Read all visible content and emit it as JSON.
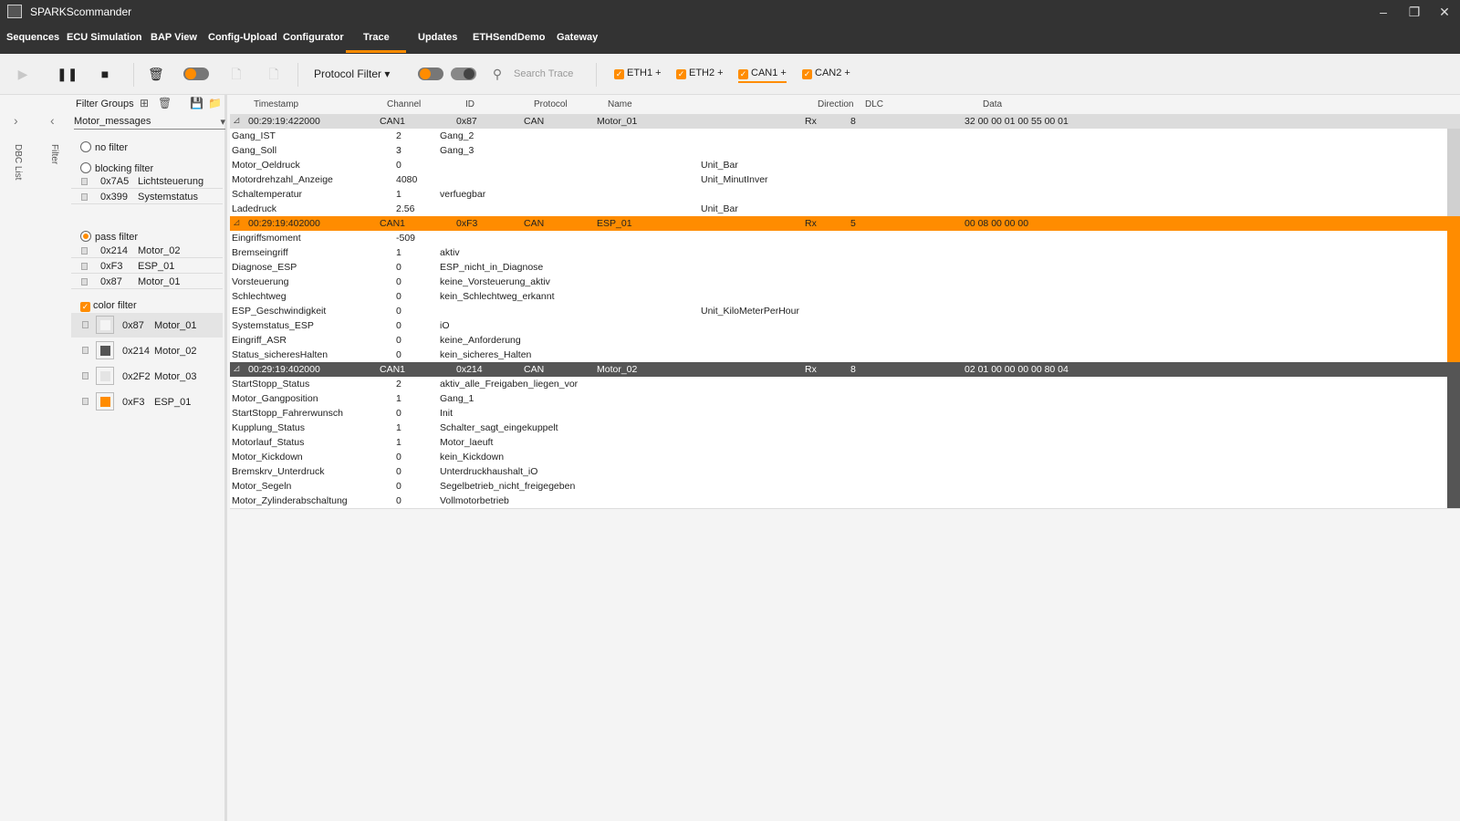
{
  "window": {
    "title": "SPARKScommander"
  },
  "menu": [
    "Sequences",
    "ECU Simulation",
    "BAP View",
    "Config-Upload",
    "Configurator",
    "Trace",
    "Updates",
    "ETHSendDemo",
    "Gateway"
  ],
  "toolbar": {
    "protocol_filter": "Protocol Filter",
    "search_placeholder": "Search Trace",
    "channels": [
      "ETH1",
      "ETH2",
      "CAN1",
      "CAN2"
    ]
  },
  "side": {
    "dbc_list": "DBC List",
    "filter": "Filter"
  },
  "filter_panel": {
    "title": "Filter Groups",
    "group": "Motor_messages",
    "no_filter": "no filter",
    "blocking_filter": "blocking filter",
    "blocking_items": [
      {
        "id": "0x7A5",
        "name": "Lichtsteuerung"
      },
      {
        "id": "0x399",
        "name": "Systemstatus"
      }
    ],
    "pass_filter": "pass filter",
    "pass_items": [
      {
        "id": "0x214",
        "name": "Motor_02"
      },
      {
        "id": "0xF3",
        "name": "ESP_01"
      },
      {
        "id": "0x87",
        "name": "Motor_01"
      }
    ],
    "color_filter": "color filter",
    "color_items": [
      {
        "id": "0x87",
        "name": "Motor_01",
        "color": "#f4f4f4"
      },
      {
        "id": "0x214",
        "name": "Motor_02",
        "color": "#555555"
      },
      {
        "id": "0x2F2",
        "name": "Motor_03",
        "color": "#e4e4e4"
      },
      {
        "id": "0xF3",
        "name": "ESP_01",
        "color": "#ff8c00"
      }
    ]
  },
  "trace": {
    "columns": [
      "Timestamp",
      "Channel",
      "ID",
      "Protocol",
      "Name",
      "Direction",
      "DLC",
      "Data"
    ],
    "messages": [
      {
        "timestamp": "00:29:19:422000",
        "channel": "CAN1",
        "id": "0x87",
        "protocol": "CAN",
        "name": "Motor_01",
        "direction": "Rx",
        "dlc": "8",
        "data": "32 00 00 01 00 55 00 01",
        "signals": [
          [
            "Gang_IST",
            "2",
            "Gang_2",
            ""
          ],
          [
            "Gang_Soll",
            "3",
            "Gang_3",
            ""
          ],
          [
            "Motor_Oeldruck",
            "0",
            "",
            "Unit_Bar"
          ],
          [
            "Motordrehzahl_Anzeige",
            "4080",
            "",
            "Unit_MinutInver"
          ],
          [
            "Schaltemperatur",
            "1",
            "verfuegbar",
            ""
          ],
          [
            "Ladedruck",
            "2.56",
            "",
            "Unit_Bar"
          ]
        ]
      },
      {
        "timestamp": "00:29:19:402000",
        "channel": "CAN1",
        "id": "0xF3",
        "protocol": "CAN",
        "name": "ESP_01",
        "direction": "Rx",
        "dlc": "5",
        "data": "00 08 00 00 00",
        "signals": [
          [
            "Eingriffsmoment",
            "-509",
            "",
            ""
          ],
          [
            "Bremseingriff",
            "1",
            "aktiv",
            ""
          ],
          [
            "Diagnose_ESP",
            "0",
            "ESP_nicht_in_Diagnose",
            ""
          ],
          [
            "Vorsteuerung",
            "0",
            "keine_Vorsteuerung_aktiv",
            ""
          ],
          [
            "Schlechtweg",
            "0",
            "kein_Schlechtweg_erkannt",
            ""
          ],
          [
            "ESP_Geschwindigkeit",
            "0",
            "",
            "Unit_KiloMeterPerHour"
          ],
          [
            "Systemstatus_ESP",
            "0",
            "iO",
            ""
          ],
          [
            "Eingriff_ASR",
            "0",
            "keine_Anforderung",
            ""
          ],
          [
            "Status_sicheresHalten",
            "0",
            "kein_sicheres_Halten",
            ""
          ]
        ]
      },
      {
        "timestamp": "00:29:19:402000",
        "channel": "CAN1",
        "id": "0x214",
        "protocol": "CAN",
        "name": "Motor_02",
        "direction": "Rx",
        "dlc": "8",
        "data": "02 01 00 00 00 00 80 04",
        "signals": [
          [
            "StartStopp_Status",
            "2",
            "aktiv_alle_Freigaben_liegen_vor",
            ""
          ],
          [
            "Motor_Gangposition",
            "1",
            "Gang_1",
            ""
          ],
          [
            "StartStopp_Fahrerwunsch",
            "0",
            "Init",
            ""
          ],
          [
            "Kupplung_Status",
            "1",
            "Schalter_sagt_eingekuppelt",
            ""
          ],
          [
            "Motorlauf_Status",
            "1",
            "Motor_laeuft",
            ""
          ],
          [
            "Motor_Kickdown",
            "0",
            "kein_Kickdown",
            ""
          ],
          [
            "Bremskrv_Unterdruck",
            "0",
            "Unterdruckhaushalt_iO",
            ""
          ],
          [
            "Motor_Segeln",
            "0",
            "Segelbetrieb_nicht_freigegeben",
            ""
          ],
          [
            "Motor_Zylinderabschaltung",
            "0",
            "Vollmotorbetrieb",
            ""
          ]
        ]
      }
    ]
  }
}
